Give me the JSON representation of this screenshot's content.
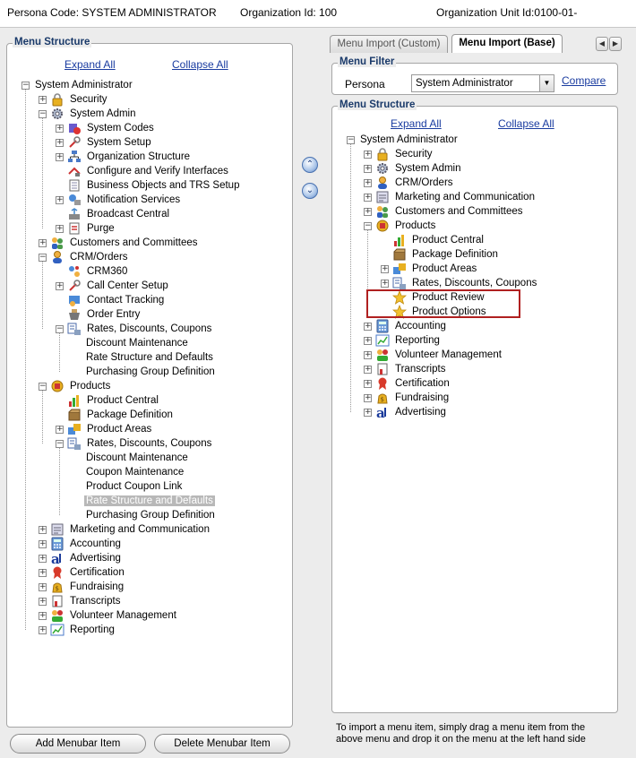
{
  "header": {
    "persona_code": "Persona Code:  SYSTEM ADMINISTRATOR",
    "org_id": "Organization Id:  100",
    "org_unit_id": "Organization Unit Id:0100-01-"
  },
  "left_panel": {
    "legend": "Menu Structure",
    "expand_all": "Expand All",
    "collapse_all": "Collapse All",
    "tree": [
      {
        "label": "System Administrator",
        "level": 0,
        "exp": "-",
        "icon": "none"
      },
      {
        "label": "Security",
        "level": 1,
        "exp": "+",
        "icon": "lock"
      },
      {
        "label": "System Admin",
        "level": 1,
        "exp": "-",
        "icon": "gear"
      },
      {
        "label": "System Codes",
        "level": 2,
        "exp": "+",
        "icon": "codes"
      },
      {
        "label": "System Setup",
        "level": 2,
        "exp": "+",
        "icon": "setup"
      },
      {
        "label": "Organization Structure",
        "level": 2,
        "exp": "+",
        "icon": "orgchart"
      },
      {
        "label": "Configure and Verify Interfaces",
        "level": 2,
        "exp": "",
        "icon": "interface"
      },
      {
        "label": "Business Objects and TRS Setup",
        "level": 2,
        "exp": "",
        "icon": "doc"
      },
      {
        "label": "Notification Services",
        "level": 2,
        "exp": "+",
        "icon": "notify"
      },
      {
        "label": "Broadcast Central",
        "level": 2,
        "exp": "",
        "icon": "broadcast"
      },
      {
        "label": "Purge",
        "level": 2,
        "exp": "+",
        "icon": "purge"
      },
      {
        "label": "Customers and Committees",
        "level": 1,
        "exp": "+",
        "icon": "people"
      },
      {
        "label": "CRM/Orders",
        "level": 1,
        "exp": "-",
        "icon": "person"
      },
      {
        "label": "CRM360",
        "level": 2,
        "exp": "",
        "icon": "crm"
      },
      {
        "label": "Call Center Setup",
        "level": 2,
        "exp": "+",
        "icon": "setup"
      },
      {
        "label": "Contact Tracking",
        "level": 2,
        "exp": "",
        "icon": "contact"
      },
      {
        "label": "Order Entry",
        "level": 2,
        "exp": "",
        "icon": "order"
      },
      {
        "label": "Rates, Discounts, Coupons",
        "level": 2,
        "exp": "-",
        "icon": "rates"
      },
      {
        "label": "Discount Maintenance",
        "level": 3,
        "exp": "",
        "icon": "none"
      },
      {
        "label": "Rate Structure and Defaults",
        "level": 3,
        "exp": "",
        "icon": "none"
      },
      {
        "label": "Purchasing Group Definition",
        "level": 3,
        "exp": "",
        "icon": "none"
      },
      {
        "label": "Products",
        "level": 1,
        "exp": "-",
        "icon": "products"
      },
      {
        "label": "Product Central",
        "level": 2,
        "exp": "",
        "icon": "productcentral"
      },
      {
        "label": "Package Definition",
        "level": 2,
        "exp": "",
        "icon": "package"
      },
      {
        "label": "Product Areas",
        "level": 2,
        "exp": "+",
        "icon": "areas"
      },
      {
        "label": "Rates, Discounts, Coupons",
        "level": 2,
        "exp": "-",
        "icon": "rates"
      },
      {
        "label": "Discount Maintenance",
        "level": 3,
        "exp": "",
        "icon": "none"
      },
      {
        "label": "Coupon Maintenance",
        "level": 3,
        "exp": "",
        "icon": "none"
      },
      {
        "label": "Product Coupon Link",
        "level": 3,
        "exp": "",
        "icon": "none"
      },
      {
        "label": "Rate Structure and Defaults",
        "level": 3,
        "exp": "",
        "icon": "none",
        "selected": true
      },
      {
        "label": "Purchasing Group Definition",
        "level": 3,
        "exp": "",
        "icon": "none"
      },
      {
        "label": "Marketing and Communication",
        "level": 1,
        "exp": "+",
        "icon": "marketing"
      },
      {
        "label": "Accounting",
        "level": 1,
        "exp": "+",
        "icon": "accounting"
      },
      {
        "label": "Advertising",
        "level": 1,
        "exp": "+",
        "icon": "advertising"
      },
      {
        "label": "Certification",
        "level": 1,
        "exp": "+",
        "icon": "certification"
      },
      {
        "label": "Fundraising",
        "level": 1,
        "exp": "+",
        "icon": "fundraising"
      },
      {
        "label": "Transcripts",
        "level": 1,
        "exp": "+",
        "icon": "transcripts"
      },
      {
        "label": "Volunteer Management",
        "level": 1,
        "exp": "+",
        "icon": "volunteer"
      },
      {
        "label": "Reporting",
        "level": 1,
        "exp": "+",
        "icon": "reporting"
      }
    ],
    "add_button": "Add Menubar Item",
    "delete_button": "Delete Menubar Item"
  },
  "right_panel": {
    "tabs": [
      "Menu Import (Custom)",
      "Menu Import (Base)"
    ],
    "active_tab": 1,
    "filter_legend": "Menu Filter",
    "persona_label": "Persona",
    "persona_value": "System Administrator",
    "compare_link": "Compare",
    "structure_legend": "Menu Structure",
    "expand_all": "Expand All",
    "collapse_all": "Collapse All",
    "tree": [
      {
        "label": "System Administrator",
        "level": 0,
        "exp": "-",
        "icon": "none"
      },
      {
        "label": "Security",
        "level": 1,
        "exp": "+",
        "icon": "lock"
      },
      {
        "label": "System Admin",
        "level": 1,
        "exp": "+",
        "icon": "gear"
      },
      {
        "label": "CRM/Orders",
        "level": 1,
        "exp": "+",
        "icon": "person"
      },
      {
        "label": "Marketing and Communication",
        "level": 1,
        "exp": "+",
        "icon": "marketing"
      },
      {
        "label": "Customers and Committees",
        "level": 1,
        "exp": "+",
        "icon": "people"
      },
      {
        "label": "Products",
        "level": 1,
        "exp": "-",
        "icon": "products"
      },
      {
        "label": "Product Central",
        "level": 2,
        "exp": "",
        "icon": "productcentral"
      },
      {
        "label": "Package Definition",
        "level": 2,
        "exp": "",
        "icon": "package"
      },
      {
        "label": "Product Areas",
        "level": 2,
        "exp": "+",
        "icon": "areas"
      },
      {
        "label": "Rates, Discounts, Coupons",
        "level": 2,
        "exp": "+",
        "icon": "rates"
      },
      {
        "label": "Product Review",
        "level": 2,
        "exp": "",
        "icon": "star"
      },
      {
        "label": "Product Options",
        "level": 2,
        "exp": "",
        "icon": "star"
      },
      {
        "label": "Accounting",
        "level": 1,
        "exp": "+",
        "icon": "accounting"
      },
      {
        "label": "Reporting",
        "level": 1,
        "exp": "+",
        "icon": "reporting"
      },
      {
        "label": "Volunteer Management",
        "level": 1,
        "exp": "+",
        "icon": "volunteer"
      },
      {
        "label": "Transcripts",
        "level": 1,
        "exp": "+",
        "icon": "transcripts"
      },
      {
        "label": "Certification",
        "level": 1,
        "exp": "+",
        "icon": "certification"
      },
      {
        "label": "Fundraising",
        "level": 1,
        "exp": "+",
        "icon": "fundraising"
      },
      {
        "label": "Advertising",
        "level": 1,
        "exp": "+",
        "icon": "advertising"
      }
    ],
    "hint_line1": "To import a menu item, simply drag a menu item from the",
    "hint_line2": "above menu and drop it on the menu at the left hand side"
  },
  "colors": {
    "legend_text": "#1a3a6a",
    "link": "#1a3ca0",
    "highlight_box": "#b02020"
  }
}
